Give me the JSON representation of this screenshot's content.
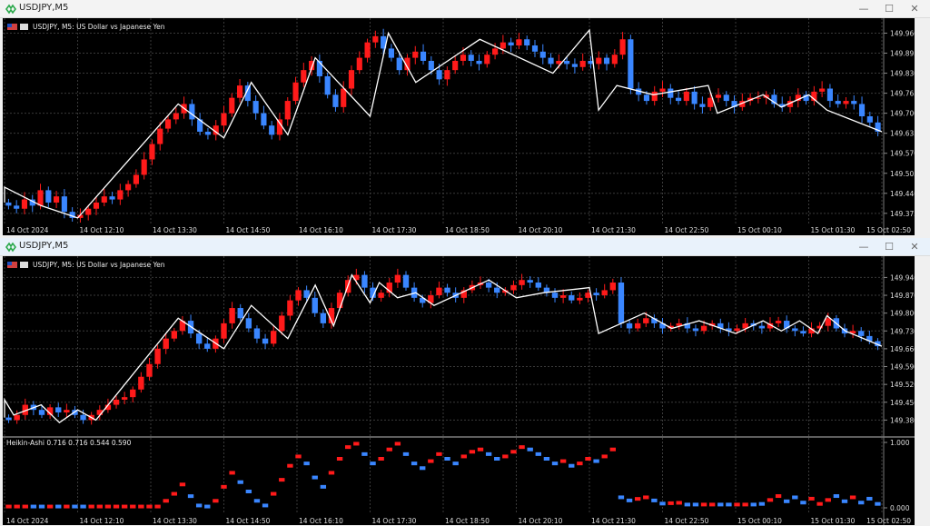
{
  "windows": [
    {
      "title": "USDJPY,M5",
      "chart_header": "USDJPY, M5:  US Dollar vs Japanese Yen",
      "controls": {
        "minimize": "—",
        "maximize": "☐",
        "close": "✕"
      }
    },
    {
      "title": "USDJPY,M5",
      "chart_header": "USDJPY, M5:  US Dollar vs Japanese Yen",
      "controls": {
        "minimize": "—",
        "maximize": "☐",
        "close": "✕"
      },
      "indicator_label": "Heikin-Ashi 0.716 0.716 0.544 0.590"
    }
  ],
  "colors": {
    "background": "#000000",
    "bull": "#ff1a1a",
    "bear": "#3a86ff",
    "zigzag": "#ffffff",
    "grid": "#3a3a3a"
  },
  "chart_data": [
    {
      "type": "candlestick",
      "title": "USDJPY, M5: US Dollar vs Japanese Yen",
      "x_ticks": [
        "14 Oct 2024",
        "14 Oct 12:10",
        "14 Oct 13:30",
        "14 Oct 14:50",
        "14 Oct 16:10",
        "14 Oct 17:30",
        "14 Oct 18:50",
        "14 Oct 20:10",
        "14 Oct 21:30",
        "14 Oct 22:50",
        "15 Oct 00:10",
        "15 Oct 01:30",
        "15 Oct 02:50"
      ],
      "y_ticks": [
        "149.960",
        "149.895",
        "149.830",
        "149.765",
        "149.700",
        "149.635",
        "149.570",
        "149.505",
        "149.440",
        "149.375"
      ],
      "ylim": [
        149.345,
        149.985
      ],
      "zigzag": {
        "x": [
          "14 Oct 2024",
          "14 Oct 10:50",
          "14 Oct 11:30",
          "14 Oct 12:10",
          "14 Oct 14:00",
          "14 Oct 14:50",
          "14 Oct 15:20",
          "14 Oct 16:00",
          "14 Oct 16:30",
          "14 Oct 17:30",
          "14 Oct 17:50",
          "14 Oct 18:20",
          "14 Oct 19:30",
          "14 Oct 20:50",
          "14 Oct 21:30",
          "14 Oct 21:40",
          "14 Oct 22:00",
          "14 Oct 22:40",
          "14 Oct 23:40",
          "14 Oct 23:50",
          "15 Oct 00:40",
          "15 Oct 01:00",
          "15 Oct 01:30",
          "15 Oct 01:50",
          "15 Oct 02:50"
        ],
        "values": [
          149.41,
          149.46,
          149.4,
          149.36,
          149.73,
          149.62,
          149.8,
          149.63,
          149.88,
          149.69,
          149.96,
          149.8,
          149.94,
          149.83,
          149.97,
          149.71,
          149.79,
          149.76,
          149.79,
          149.7,
          149.76,
          149.72,
          149.76,
          149.71,
          149.64
        ]
      },
      "candles": {
        "close": [
          149.4,
          149.39,
          149.42,
          149.4,
          149.45,
          149.41,
          149.43,
          149.38,
          149.36,
          149.37,
          149.39,
          149.41,
          149.43,
          149.42,
          149.45,
          149.47,
          149.5,
          149.55,
          149.6,
          149.65,
          149.68,
          149.7,
          149.73,
          149.68,
          149.64,
          149.63,
          149.66,
          149.7,
          149.75,
          149.79,
          149.74,
          149.7,
          149.66,
          149.63,
          149.68,
          149.74,
          149.8,
          149.84,
          149.87,
          149.82,
          149.76,
          149.72,
          149.78,
          149.84,
          149.88,
          149.93,
          149.95,
          149.91,
          149.88,
          149.84,
          149.88,
          149.9,
          149.87,
          149.84,
          149.81,
          149.84,
          149.87,
          149.89,
          149.87,
          149.86,
          149.89,
          149.91,
          149.93,
          149.92,
          149.94,
          149.92,
          149.9,
          149.88,
          149.86,
          149.87,
          149.86,
          149.85,
          149.87,
          149.86,
          149.88,
          149.86,
          149.89,
          149.94,
          149.78,
          149.76,
          149.74,
          149.77,
          149.78,
          149.75,
          149.74,
          149.77,
          149.73,
          149.72,
          149.75,
          149.76,
          149.74,
          149.72,
          149.74,
          149.75,
          149.75,
          149.76,
          149.73,
          149.72,
          149.74,
          149.76,
          149.74,
          149.77,
          149.78,
          149.74,
          149.73,
          149.74,
          149.73,
          149.69,
          149.67,
          149.64
        ]
      }
    },
    {
      "type": "candlestick",
      "title": "USDJPY, M5: US Dollar vs Japanese Yen",
      "x_ticks": [
        "14 Oct 2024",
        "14 Oct 12:10",
        "14 Oct 13:30",
        "14 Oct 14:50",
        "14 Oct 16:10",
        "14 Oct 17:30",
        "14 Oct 18:50",
        "14 Oct 20:10",
        "14 Oct 21:30",
        "14 Oct 22:50",
        "15 Oct 00:10",
        "15 Oct 01:30",
        "15 Oct 02:50"
      ],
      "y_ticks": [
        "149.940",
        "149.870",
        "149.800",
        "149.730",
        "149.660",
        "149.590",
        "149.520",
        "149.450",
        "149.380"
      ],
      "ylim": [
        149.335,
        149.995
      ],
      "zigzag": {
        "x": [
          "14 Oct 2024",
          "14 Oct 10:40",
          "14 Oct 11:00",
          "14 Oct 11:30",
          "14 Oct 11:50",
          "14 Oct 12:10",
          "14 Oct 12:30",
          "14 Oct 14:00",
          "14 Oct 14:50",
          "14 Oct 15:20",
          "14 Oct 16:00",
          "14 Oct 16:30",
          "14 Oct 16:50",
          "14 Oct 17:10",
          "14 Oct 17:30",
          "14 Oct 17:40",
          "14 Oct 18:00",
          "14 Oct 18:20",
          "14 Oct 18:40",
          "14 Oct 19:40",
          "14 Oct 20:10",
          "14 Oct 20:40",
          "14 Oct 21:30",
          "14 Oct 21:40",
          "14 Oct 22:30",
          "14 Oct 23:00",
          "14 Oct 23:30",
          "15 Oct 00:10",
          "15 Oct 00:40",
          "15 Oct 01:00",
          "15 Oct 01:20",
          "15 Oct 01:40",
          "15 Oct 01:50",
          "15 Oct 02:10",
          "15 Oct 02:50"
        ],
        "values": [
          149.39,
          149.46,
          149.4,
          149.44,
          149.37,
          149.42,
          149.38,
          149.78,
          149.66,
          149.83,
          149.7,
          149.91,
          149.75,
          149.95,
          149.84,
          149.92,
          149.86,
          149.88,
          149.83,
          149.93,
          149.86,
          149.88,
          149.9,
          149.72,
          149.8,
          149.74,
          149.77,
          149.72,
          149.77,
          149.73,
          149.77,
          149.72,
          149.79,
          149.73,
          149.67
        ]
      },
      "candles": {
        "close": [
          149.38,
          149.4,
          149.44,
          149.42,
          149.4,
          149.43,
          149.41,
          149.42,
          149.4,
          149.38,
          149.4,
          149.42,
          149.44,
          149.46,
          149.47,
          149.5,
          149.55,
          149.6,
          149.66,
          149.7,
          149.73,
          149.77,
          149.72,
          149.68,
          149.66,
          149.7,
          149.76,
          149.82,
          149.78,
          149.74,
          149.7,
          149.68,
          149.73,
          149.79,
          149.85,
          149.89,
          149.86,
          149.8,
          149.76,
          149.82,
          149.88,
          149.93,
          149.95,
          149.9,
          149.86,
          149.88,
          149.92,
          149.95,
          149.9,
          149.86,
          149.84,
          149.87,
          149.9,
          149.88,
          149.86,
          149.89,
          149.91,
          149.92,
          149.9,
          149.88,
          149.89,
          149.91,
          149.93,
          149.92,
          149.9,
          149.88,
          149.86,
          149.87,
          149.85,
          149.86,
          149.88,
          149.87,
          149.89,
          149.92,
          149.76,
          149.74,
          149.76,
          149.78,
          149.76,
          149.74,
          149.75,
          149.76,
          149.74,
          149.73,
          149.75,
          149.76,
          149.74,
          149.73,
          149.74,
          149.76,
          149.75,
          149.74,
          149.76,
          149.77,
          149.74,
          149.73,
          149.72,
          149.74,
          149.75,
          149.78,
          149.74,
          149.72,
          149.73,
          149.71,
          149.69,
          149.67
        ]
      }
    },
    {
      "type": "bar",
      "title": "Heikin-Ashi 0.716 0.716 0.544 0.590",
      "y_ticks": [
        "1.000",
        "0.000"
      ],
      "ylim": [
        0,
        1
      ]
    }
  ]
}
